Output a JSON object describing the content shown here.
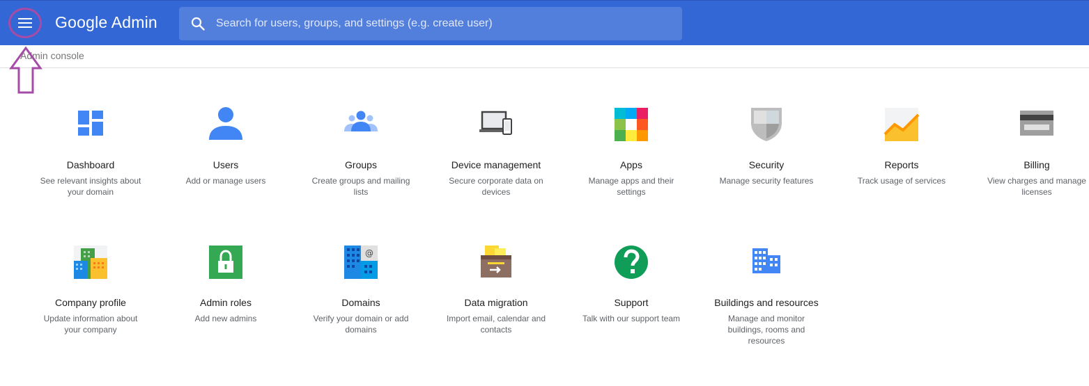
{
  "header": {
    "brand_google": "Google",
    "brand_product": "Admin",
    "search_placeholder": "Search for users, groups, and settings (e.g. create user)",
    "color": "#3367d6"
  },
  "breadcrumb": "Admin console",
  "annotation": {
    "highlight_color": "#a64ca6",
    "target": "main-menu-icon"
  },
  "tiles": [
    {
      "title": "Dashboard",
      "desc": "See relevant insights about your domain",
      "icon": "dashboard-icon"
    },
    {
      "title": "Users",
      "desc": "Add or manage users",
      "icon": "user-icon"
    },
    {
      "title": "Groups",
      "desc": "Create groups and mailing lists",
      "icon": "groups-icon"
    },
    {
      "title": "Device management",
      "desc": "Secure corporate data on devices",
      "icon": "devices-icon"
    },
    {
      "title": "Apps",
      "desc": "Manage apps and their settings",
      "icon": "apps-icon"
    },
    {
      "title": "Security",
      "desc": "Manage security features",
      "icon": "shield-icon"
    },
    {
      "title": "Reports",
      "desc": "Track usage of services",
      "icon": "reports-chart-icon"
    },
    {
      "title": "Billing",
      "desc": "View charges and manage licenses",
      "icon": "credit-card-icon"
    },
    {
      "title": "Company profile",
      "desc": "Update information about your company",
      "icon": "company-buildings-icon"
    },
    {
      "title": "Admin roles",
      "desc": "Add new admins",
      "icon": "lock-icon"
    },
    {
      "title": "Domains",
      "desc": "Verify your domain or add domains",
      "icon": "domains-icon"
    },
    {
      "title": "Data migration",
      "desc": "Import email, calendar and contacts",
      "icon": "migration-box-icon"
    },
    {
      "title": "Support",
      "desc": "Talk with our support team",
      "icon": "question-mark-icon"
    },
    {
      "title": "Buildings and resources",
      "desc": "Manage and monitor buildings, rooms and resources",
      "icon": "building-icon"
    }
  ]
}
